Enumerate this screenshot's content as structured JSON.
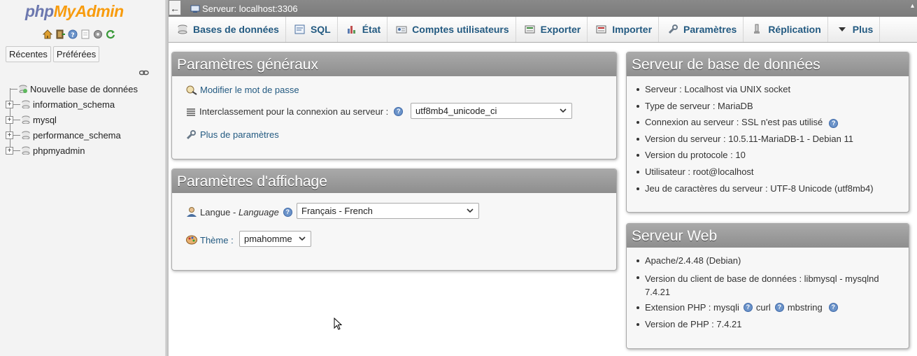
{
  "nav": {
    "logo_part1": "php",
    "logo_part2": "MyAdmin",
    "icons": [
      "home-icon",
      "exit-icon",
      "help-icon",
      "docs-icon",
      "settings-icon",
      "reload-icon"
    ],
    "recent_label": "Récentes",
    "favorites_label": "Préférées",
    "new_database_label": "Nouvelle base de données",
    "databases": [
      "information_schema",
      "mysql",
      "performance_schema",
      "phpmyadmin"
    ]
  },
  "topbar": {
    "back_label": "←",
    "server_label": "Serveur: localhost:3306"
  },
  "tabs": [
    {
      "label": "Bases de données",
      "icon": "database-icon"
    },
    {
      "label": "SQL",
      "icon": "sql-icon"
    },
    {
      "label": "État",
      "icon": "status-icon"
    },
    {
      "label": "Comptes utilisateurs",
      "icon": "users-icon"
    },
    {
      "label": "Exporter",
      "icon": "export-icon"
    },
    {
      "label": "Importer",
      "icon": "import-icon"
    },
    {
      "label": "Paramètres",
      "icon": "wrench-icon"
    },
    {
      "label": "Réplication",
      "icon": "replication-icon"
    },
    {
      "label": "Plus",
      "icon": "caret-down-icon"
    }
  ],
  "general": {
    "title": "Paramètres généraux",
    "change_password": "Modifier le mot de passe",
    "collation_label": "Interclassement pour la connexion au serveur :",
    "collation_value": "utf8mb4_unicode_ci",
    "more_settings": "Plus de paramètres"
  },
  "display": {
    "title": "Paramètres d'affichage",
    "language_label": "Langue - ",
    "language_label_italic": "Language",
    "language_value": "Français - French",
    "theme_label": "Thème :",
    "theme_value": "pmahomme"
  },
  "db_server": {
    "title": "Serveur de base de données",
    "items": [
      "Serveur : Localhost via UNIX socket",
      "Type de serveur : MariaDB",
      "Connexion au serveur : SSL n'est pas utilisé",
      "Version du serveur : 10.5.11-MariaDB-1 - Debian 11",
      "Version du protocole : 10",
      "Utilisateur : root@localhost",
      "Jeu de caractères du serveur : UTF-8 Unicode (utf8mb4)"
    ]
  },
  "web_server": {
    "title": "Serveur Web",
    "apache": "Apache/2.4.48 (Debian)",
    "client_version_line1": "Version du client de base de données : libmysql - mysqlnd",
    "client_version_line2": "7.4.21",
    "php_ext_label": "Extension PHP : mysqli",
    "php_ext_curl": "curl",
    "php_ext_mbstring": "mbstring",
    "php_version": "Version de PHP : 7.4.21"
  },
  "colors": {
    "link": "#235a81",
    "panel_header": "#9a9a9a",
    "logo_php": "#6c78af",
    "logo_myadmin": "#f89c0e"
  }
}
